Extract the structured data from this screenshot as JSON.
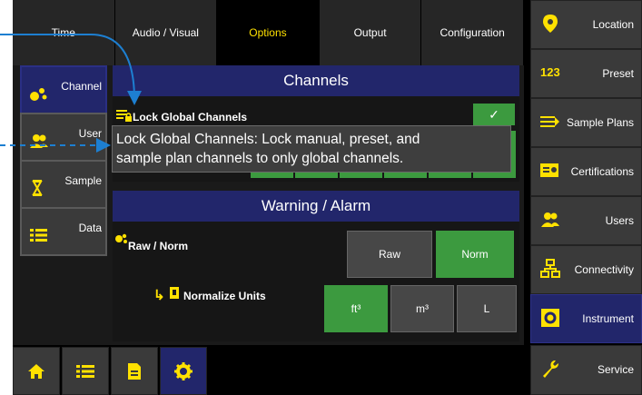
{
  "tabs": [
    {
      "label": "Time",
      "active": false
    },
    {
      "label": "Audio / Visual",
      "active": false
    },
    {
      "label": "Options",
      "active": true
    },
    {
      "label": "Output",
      "active": false
    },
    {
      "label": "Configuration",
      "active": false
    }
  ],
  "leftnav": [
    {
      "label": "Channel",
      "icon": "dots-icon",
      "active": true
    },
    {
      "label": "User",
      "icon": "users-icon",
      "active": false
    },
    {
      "label": "Sample",
      "icon": "hourglass-icon",
      "active": false
    },
    {
      "label": "Data",
      "icon": "list-icon",
      "active": false
    }
  ],
  "channels": {
    "title": "Channels",
    "lock_label": "Lock Global Channels",
    "lock_checked": true,
    "lock_check_glyph": "✓",
    "partial_value": "0"
  },
  "warning": {
    "title": "Warning / Alarm",
    "raw_norm_label": "Raw / Norm",
    "raw_label": "Raw",
    "norm_label": "Norm",
    "norm_selected": true,
    "normalize_units_label": "Normalize Units",
    "units": [
      "ft³",
      "m³",
      "L"
    ],
    "selected_unit": "ft³",
    "arrow_glyph": "↳"
  },
  "tooltip": {
    "line1": "Lock Global Channels: Lock manual, preset, and",
    "line2": "sample plan channels to only global channels."
  },
  "rightnav": [
    {
      "label": "Location",
      "icon": "location-pin-icon",
      "active": false
    },
    {
      "label": "Preset",
      "icon": "123-icon",
      "icon_text": "123",
      "active": false
    },
    {
      "label": "Sample Plans",
      "icon": "sample-plans-icon",
      "active": false
    },
    {
      "label": "Certifications",
      "icon": "certificate-icon",
      "active": false
    },
    {
      "label": "Users",
      "icon": "users-icon",
      "active": false
    },
    {
      "label": "Connectivity",
      "icon": "network-icon",
      "active": false
    },
    {
      "label": "Instrument",
      "icon": "gear-icon",
      "active": true
    },
    {
      "label": "Service",
      "icon": "wrench-icon",
      "active": false
    }
  ],
  "bottombar": [
    {
      "icon": "home-icon"
    },
    {
      "icon": "list-icon"
    },
    {
      "icon": "document-icon"
    },
    {
      "icon": "gear-icon",
      "active": true
    }
  ],
  "colors": {
    "accent_yellow": "#ffe100",
    "header_blue": "#22266b",
    "green": "#3c9a3f",
    "callout_blue": "#1d7fd1"
  }
}
